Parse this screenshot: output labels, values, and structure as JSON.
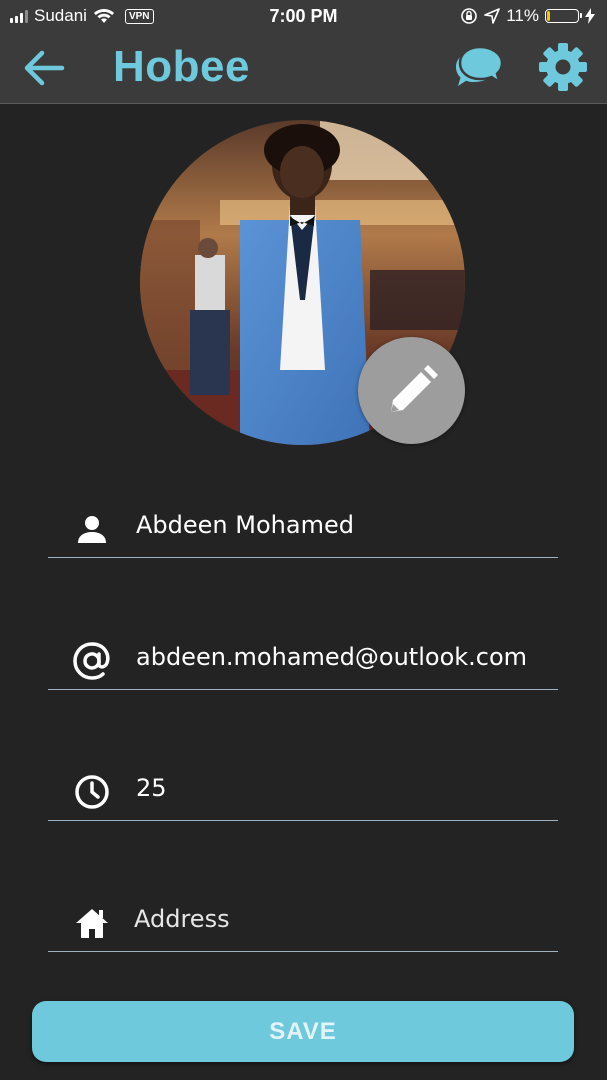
{
  "status_bar": {
    "carrier": "Sudani",
    "vpn": "VPN",
    "time": "7:00 PM",
    "battery": "11%",
    "battery_level": 0.11
  },
  "app_bar": {
    "title": "Hobee",
    "accent_color": "#6ec9dc",
    "icons": [
      "back-arrow-icon",
      "chat-icon",
      "gear-icon"
    ]
  },
  "profile": {
    "photo_icon": "edit-pencil-icon"
  },
  "form": {
    "name": {
      "icon": "person-icon",
      "value": "Abdeen Mohamed"
    },
    "email": {
      "icon": "at-icon",
      "value": "abdeen.mohamed@outlook.com"
    },
    "age": {
      "icon": "clock-icon",
      "value": "25"
    },
    "address": {
      "icon": "home-icon",
      "placeholder": "Address"
    }
  },
  "save_label": "SAVE"
}
